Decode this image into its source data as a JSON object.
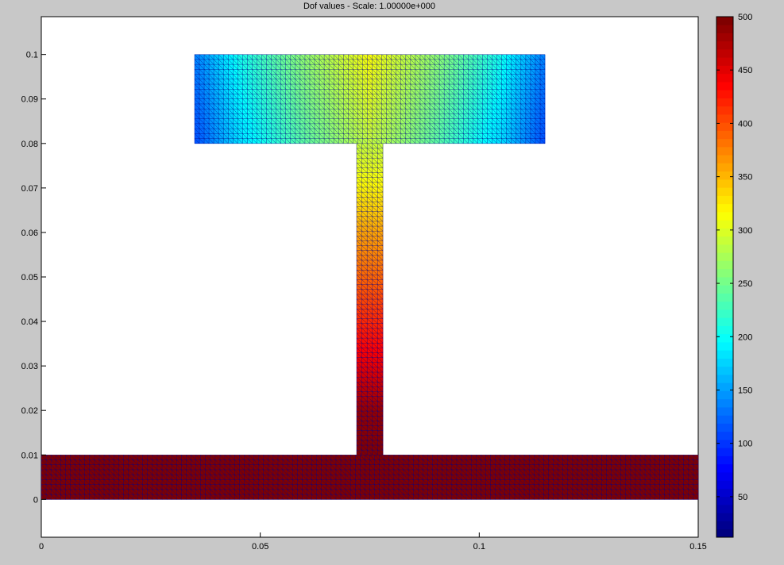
{
  "window": {
    "background": "#c8c8c8"
  },
  "chart_data": [
    {
      "type": "heatmap",
      "title": "Dof values - Scale: 1.00000e+000",
      "xlabel": "",
      "ylabel": "",
      "xlim": [
        0,
        0.15
      ],
      "ylim": [
        -0.0085,
        0.1085
      ],
      "x_ticks": [
        "0",
        "0.05",
        "0.1",
        "0.15"
      ],
      "x_tick_values": [
        0,
        0.05,
        0.1,
        0.15
      ],
      "y_ticks": [
        "0",
        "0.01",
        "0.02",
        "0.03",
        "0.04",
        "0.05",
        "0.06",
        "0.07",
        "0.08",
        "0.09",
        "0.1"
      ],
      "y_tick_values": [
        0,
        0.01,
        0.02,
        0.03,
        0.04,
        0.05,
        0.06,
        0.07,
        0.08,
        0.09,
        0.1
      ],
      "grid": false,
      "colormap": "jet",
      "mesh_color": "#00008b",
      "regions": [
        {
          "name": "base plate",
          "x": [
            0,
            0.15
          ],
          "y": [
            0,
            0.01
          ],
          "value": 500
        },
        {
          "name": "stem",
          "x": [
            0.072,
            0.078
          ],
          "y": [
            0.01,
            0.08
          ],
          "value_profile": [
            [
              0.01,
              500
            ],
            [
              0.02,
              490
            ],
            [
              0.03,
              450
            ],
            [
              0.04,
              420
            ],
            [
              0.05,
              390
            ],
            [
              0.06,
              360
            ],
            [
              0.07,
              320
            ],
            [
              0.08,
              290
            ]
          ]
        },
        {
          "name": "top flange",
          "x": [
            0.035,
            0.115
          ],
          "y": [
            0.08,
            0.1
          ],
          "value_profile_x": [
            [
              0.035,
              110
            ],
            [
              0.045,
              180
            ],
            [
              0.06,
              240
            ],
            [
              0.075,
              290
            ],
            [
              0.09,
              240
            ],
            [
              0.105,
              180
            ],
            [
              0.115,
              110
            ]
          ]
        }
      ]
    },
    {
      "type": "colorbar",
      "range": [
        12,
        500
      ],
      "ticks": [
        "50",
        "100",
        "150",
        "200",
        "250",
        "300",
        "350",
        "400",
        "450",
        "500"
      ],
      "tick_values": [
        50,
        100,
        150,
        200,
        250,
        300,
        350,
        400,
        450,
        500
      ]
    }
  ]
}
